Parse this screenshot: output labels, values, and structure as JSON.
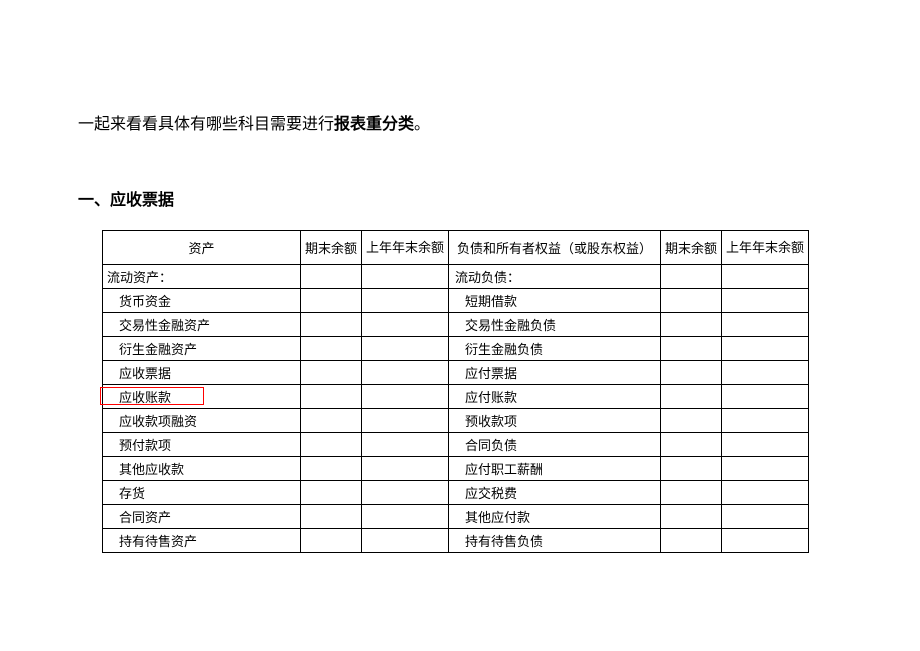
{
  "intro_part1": "一起来看看具体有哪些科目需要进行",
  "intro_bold": "报表重分类",
  "intro_part2": "。",
  "section_title": "一、应收票据",
  "headers": {
    "asset": "资产",
    "end_bal": "期末余额",
    "last_year_l1": " ",
    "last_year_l2": "上年年末余额",
    "liab": "负债和所有者权益（或股东权益）",
    "end_bal2": "期末余额",
    "last_year2_l1": " ",
    "last_year2_l2": "上年年末余额"
  },
  "rows": [
    {
      "asset": "流动资产：",
      "asset_indent": false,
      "liab": "流动负债：",
      "liab_indent": false
    },
    {
      "asset": "货币资金",
      "asset_indent": true,
      "liab": "短期借款",
      "liab_indent": true
    },
    {
      "asset": "交易性金融资产",
      "asset_indent": true,
      "liab": "交易性金融负债",
      "liab_indent": true
    },
    {
      "asset": "衍生金融资产",
      "asset_indent": true,
      "liab": "衍生金融负债",
      "liab_indent": true
    },
    {
      "asset": "应收票据",
      "asset_indent": true,
      "liab": "应付票据",
      "liab_indent": true
    },
    {
      "asset": "应收账款",
      "asset_indent": true,
      "liab": "应付账款",
      "liab_indent": true
    },
    {
      "asset": "应收款项融资",
      "asset_indent": true,
      "liab": "预收款项",
      "liab_indent": true,
      "highlight": true
    },
    {
      "asset": "预付款项",
      "asset_indent": true,
      "liab": "合同负债",
      "liab_indent": true
    },
    {
      "asset": "其他应收款",
      "asset_indent": true,
      "liab": "应付职工薪酬",
      "liab_indent": true
    },
    {
      "asset": "存货",
      "asset_indent": true,
      "liab": "应交税费",
      "liab_indent": true
    },
    {
      "asset": "合同资产",
      "asset_indent": true,
      "liab": "其他应付款",
      "liab_indent": true
    },
    {
      "asset": "持有待售资产",
      "asset_indent": true,
      "liab": "持有待售负债",
      "liab_indent": true
    }
  ]
}
